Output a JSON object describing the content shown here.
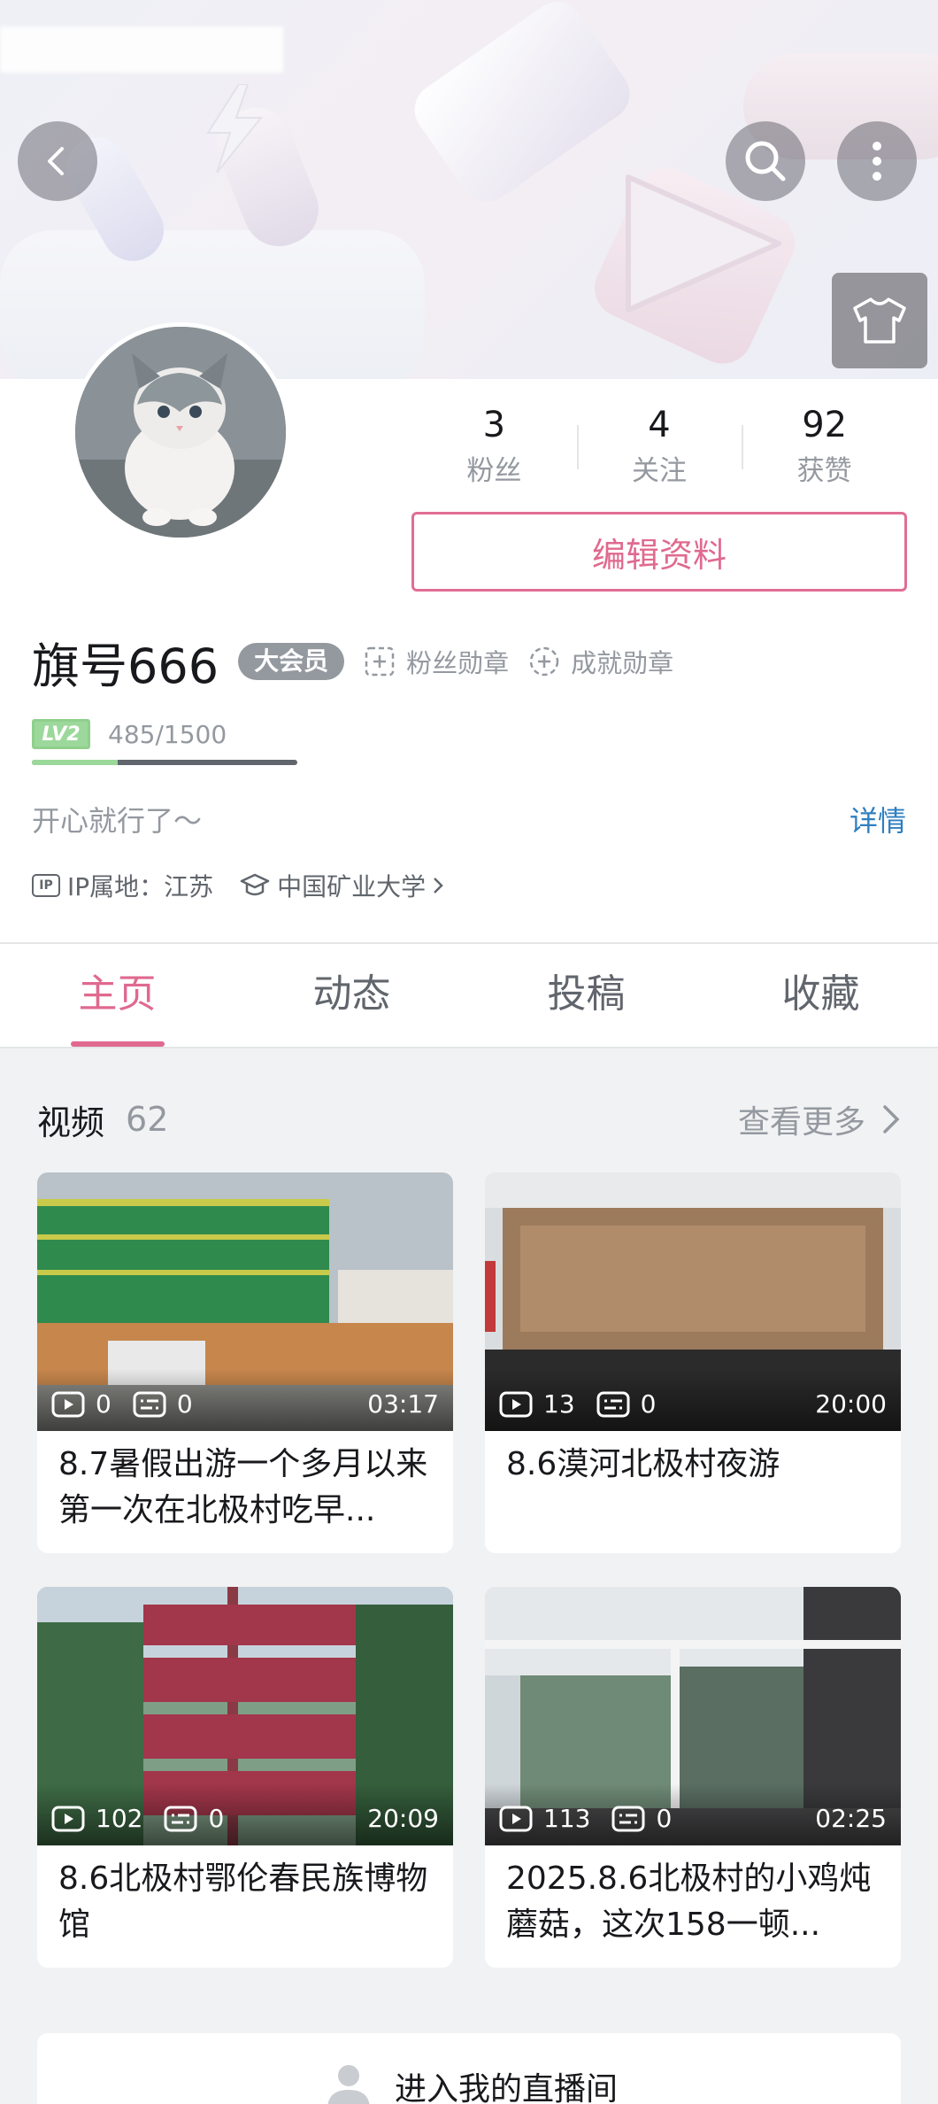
{
  "header": {
    "back_icon": "chevron-left-icon",
    "search_icon": "search-icon",
    "more_icon": "more-vertical-icon",
    "dress_icon": "t-shirt-icon"
  },
  "profile": {
    "stats": [
      {
        "value": "3",
        "label": "粉丝"
      },
      {
        "value": "4",
        "label": "关注"
      },
      {
        "value": "92",
        "label": "获赞"
      }
    ],
    "edit_label": "编辑资料",
    "name": "旗号666",
    "vip_label": "大会员",
    "fan_medal_label": "粉丝勋章",
    "achievement_label": "成就勋章",
    "level_label": "LV2",
    "exp_text": "485/1500",
    "exp_fraction": 0.323,
    "signature": "开心就行了～",
    "detail_label": "详情",
    "ip_badge": "IP",
    "ip_text": "IP属地：江苏",
    "school": "中国矿业大学"
  },
  "tabs": [
    {
      "label": "主页",
      "active": true
    },
    {
      "label": "动态",
      "active": false
    },
    {
      "label": "投稿",
      "active": false
    },
    {
      "label": "收藏",
      "active": false
    }
  ],
  "videos_section": {
    "title": "视频",
    "count": "62",
    "more_label": "查看更多"
  },
  "videos": [
    {
      "plays": "0",
      "comments": "0",
      "duration": "03:17",
      "title": "8.7暑假出游一个多月以来第一次在北极村吃早..."
    },
    {
      "plays": "13",
      "comments": "0",
      "duration": "20:00",
      "title": "8.6漠河北极村夜游"
    },
    {
      "plays": "102",
      "comments": "0",
      "duration": "20:09",
      "title": "8.6北极村鄂伦春民族博物馆"
    },
    {
      "plays": "113",
      "comments": "0",
      "duration": "02:25",
      "title": "2025.8.6北极村的小鸡炖蘑菇，这次158一顿..."
    }
  ],
  "live": {
    "label": "进入我的直播间"
  },
  "colors": {
    "accent": "#e0698f",
    "link": "#2f7fc1",
    "level": "#9bd89a"
  }
}
